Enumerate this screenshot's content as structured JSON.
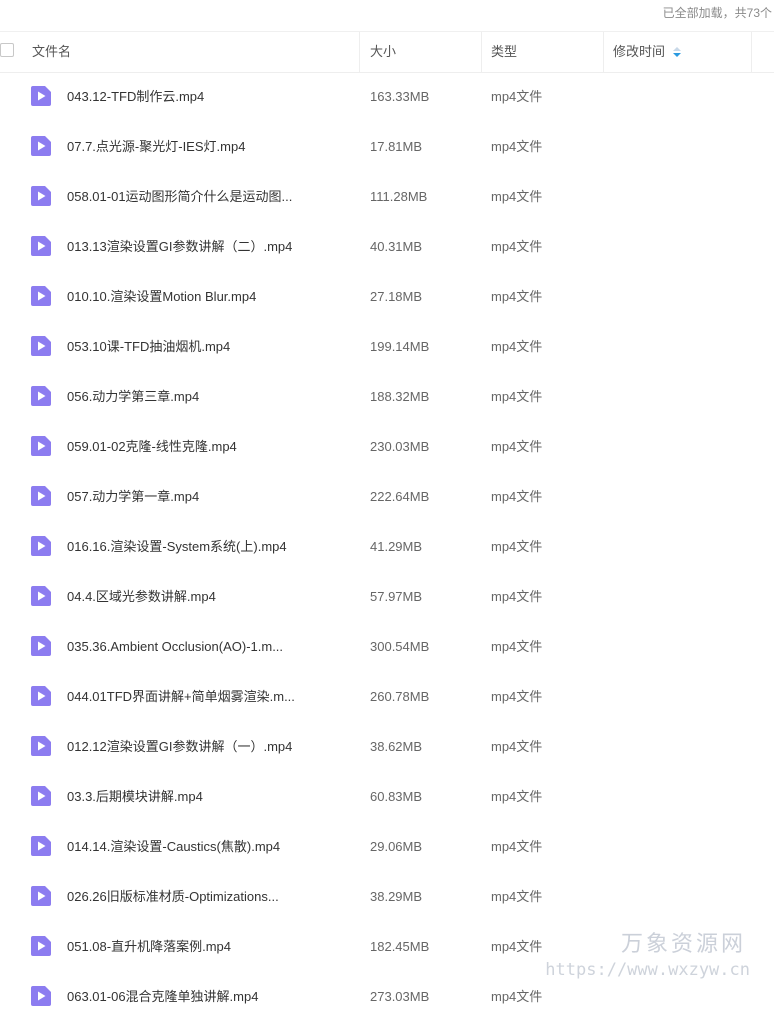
{
  "status": {
    "loaded_text": "已全部加载，共73个"
  },
  "header": {
    "name": "文件名",
    "size": "大小",
    "type": "类型",
    "modified": "修改时间"
  },
  "colors": {
    "file_icon": "#8c7cf0",
    "sort_icon_active": "#2a9ae0",
    "sort_icon_inactive": "#c8d8e8"
  },
  "icon_names": {
    "file": "video-file-icon",
    "sort": "sort-icon"
  },
  "files": [
    {
      "name": "043.12-TFD制作云.mp4",
      "size": "163.33MB",
      "type": "mp4文件"
    },
    {
      "name": "07.7.点光源-聚光灯-IES灯.mp4",
      "size": "17.81MB",
      "type": "mp4文件"
    },
    {
      "name": "058.01-01运动图形简介什么是运动图...",
      "size": "111.28MB",
      "type": "mp4文件"
    },
    {
      "name": "013.13渲染设置GI参数讲解（二）.mp4",
      "size": "40.31MB",
      "type": "mp4文件"
    },
    {
      "name": "010.10.渲染设置Motion Blur.mp4",
      "size": "27.18MB",
      "type": "mp4文件"
    },
    {
      "name": "053.10课-TFD抽油烟机.mp4",
      "size": "199.14MB",
      "type": "mp4文件"
    },
    {
      "name": "056.动力学第三章.mp4",
      "size": "188.32MB",
      "type": "mp4文件"
    },
    {
      "name": "059.01-02克隆-线性克隆.mp4",
      "size": "230.03MB",
      "type": "mp4文件"
    },
    {
      "name": "057.动力学第一章.mp4",
      "size": "222.64MB",
      "type": "mp4文件"
    },
    {
      "name": "016.16.渲染设置-System系统(上).mp4",
      "size": "41.29MB",
      "type": "mp4文件"
    },
    {
      "name": "04.4.区域光参数讲解.mp4",
      "size": "57.97MB",
      "type": "mp4文件"
    },
    {
      "name": "035.36.Ambient Occlusion(AO)-1.m...",
      "size": "300.54MB",
      "type": "mp4文件"
    },
    {
      "name": "044.01TFD界面讲解+简单烟雾渲染.m...",
      "size": "260.78MB",
      "type": "mp4文件"
    },
    {
      "name": "012.12渲染设置GI参数讲解（一）.mp4",
      "size": "38.62MB",
      "type": "mp4文件"
    },
    {
      "name": "03.3.后期模块讲解.mp4",
      "size": "60.83MB",
      "type": "mp4文件"
    },
    {
      "name": "014.14.渲染设置-Caustics(焦散).mp4",
      "size": "29.06MB",
      "type": "mp4文件"
    },
    {
      "name": "026.26旧版标准材质-Optimizations...",
      "size": "38.29MB",
      "type": "mp4文件"
    },
    {
      "name": "051.08-直升机降落案例.mp4",
      "size": "182.45MB",
      "type": "mp4文件"
    },
    {
      "name": "063.01-06混合克隆单独讲解.mp4",
      "size": "273.03MB",
      "type": "mp4文件"
    }
  ],
  "watermark": {
    "title": "万象资源网",
    "url": "https://www.wxzyw.cn"
  }
}
